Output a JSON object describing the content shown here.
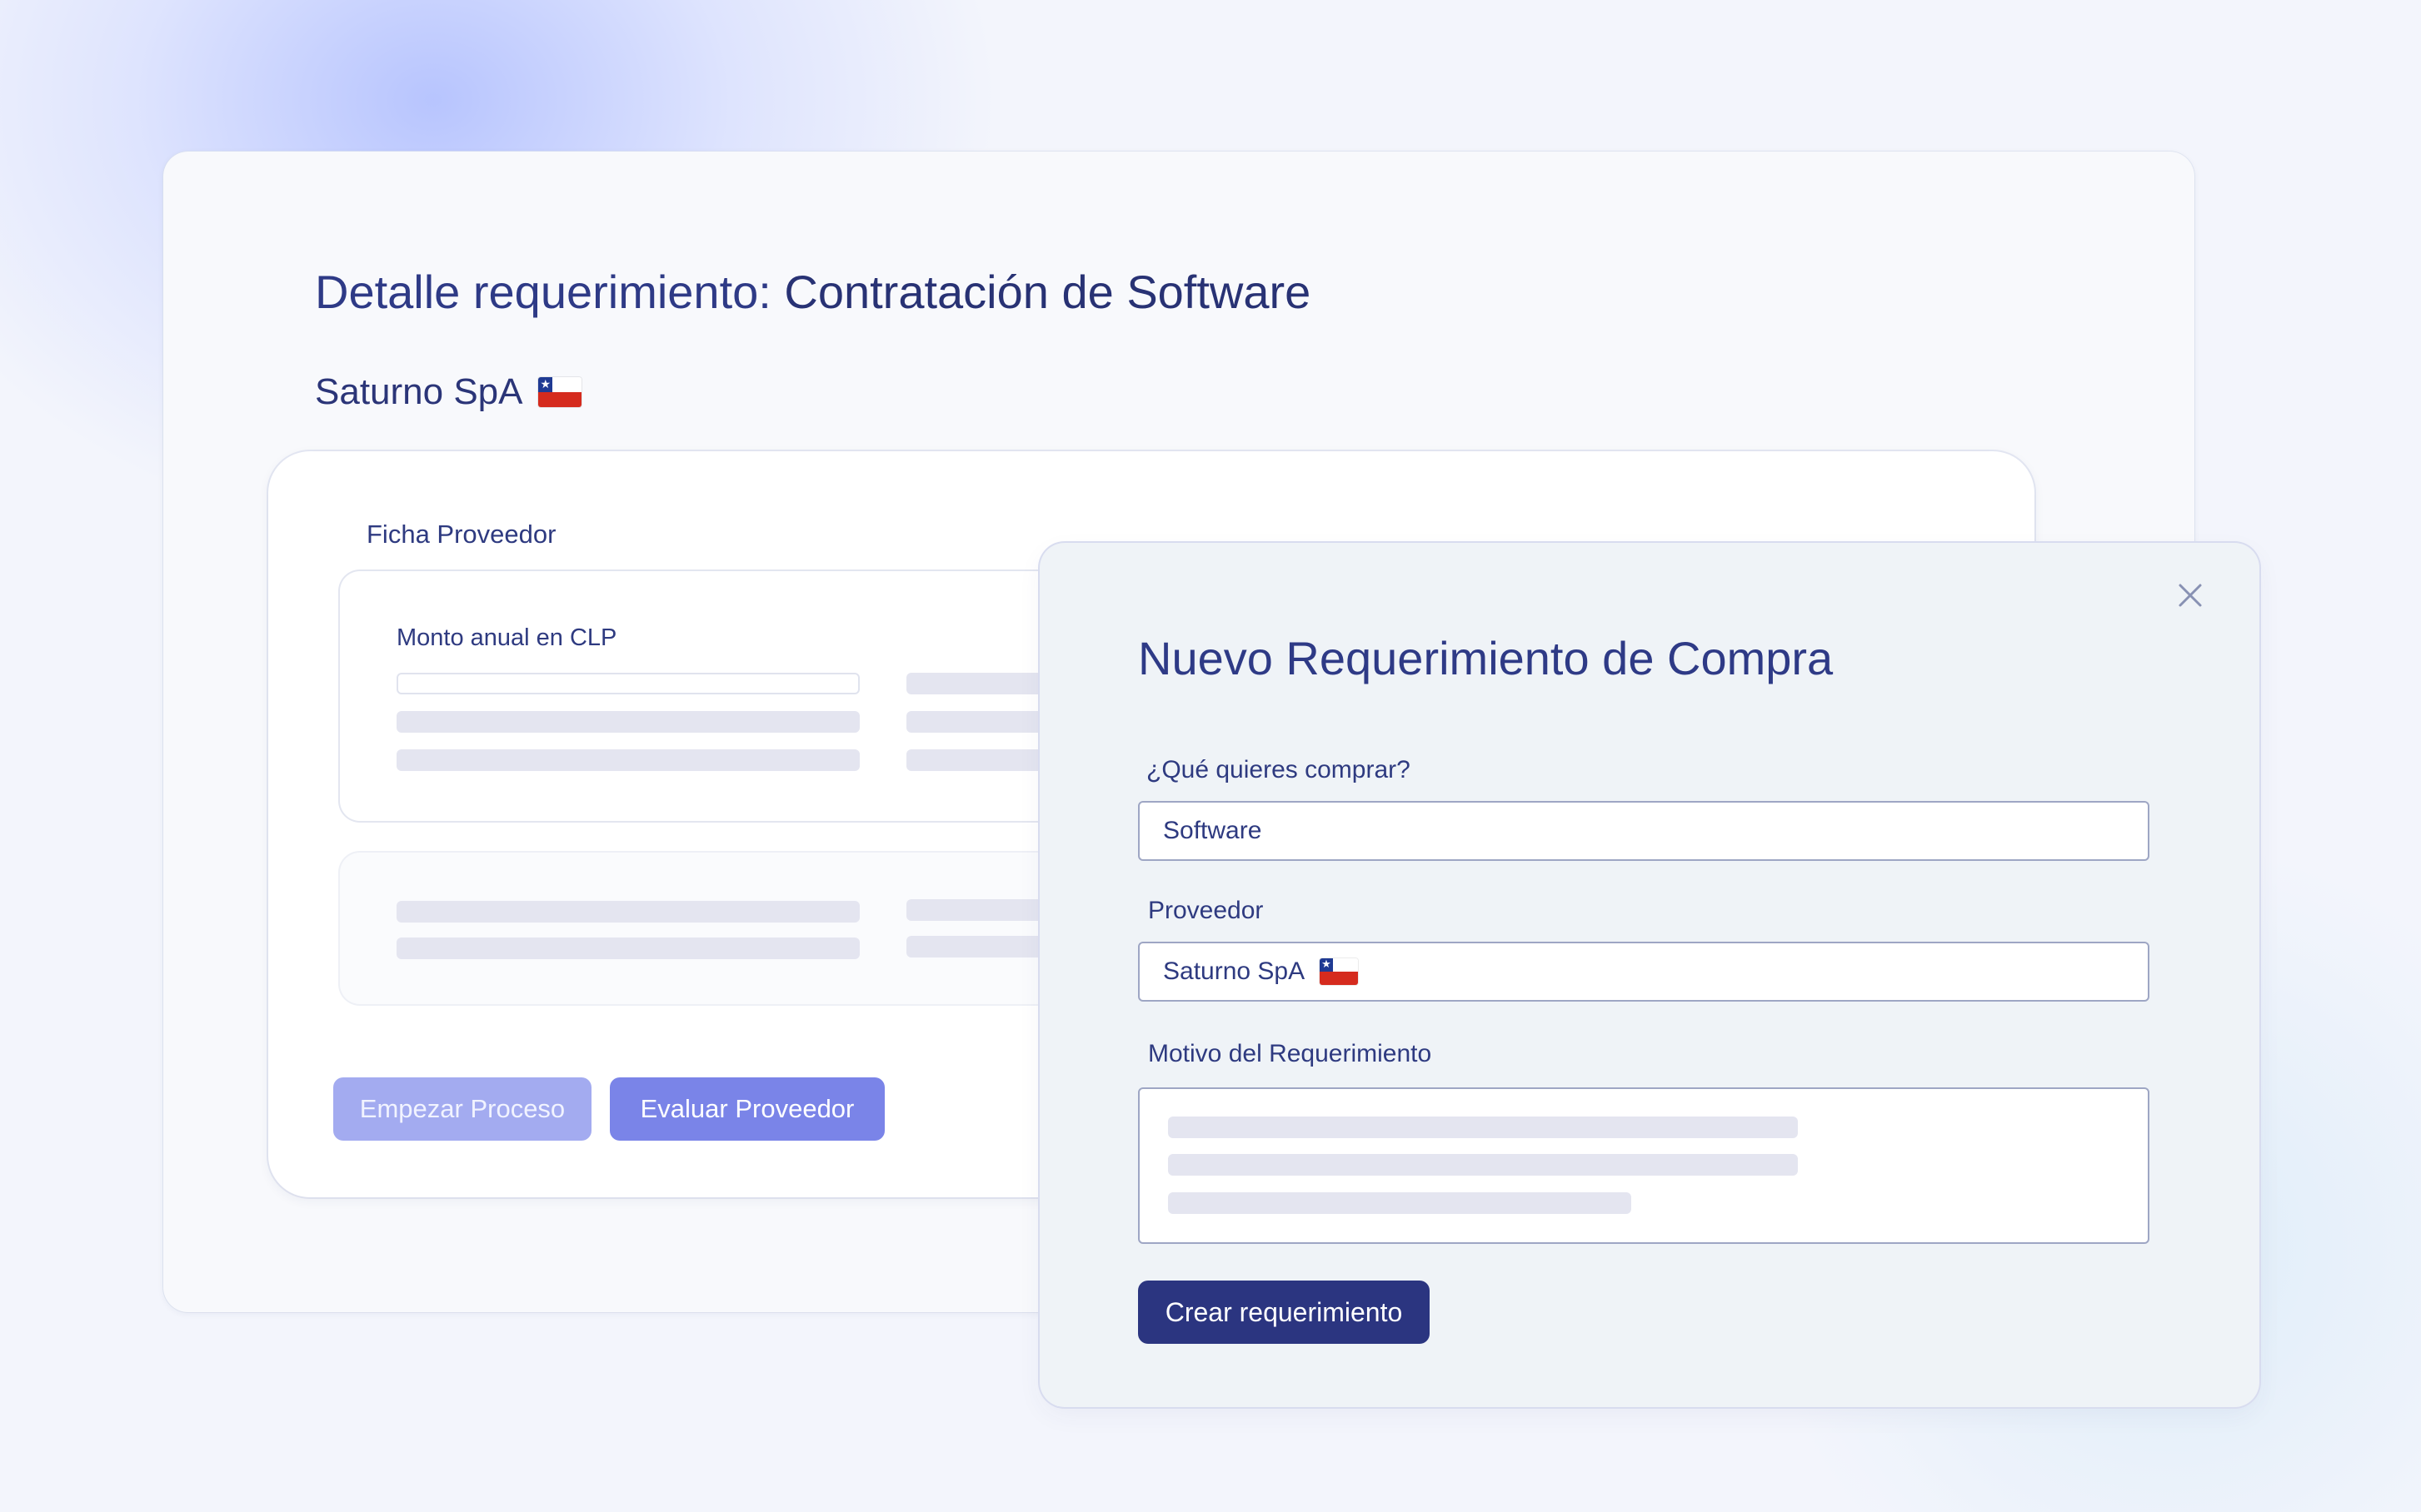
{
  "page": {
    "title_prefix": "Detalle requerimiento: ",
    "title_name": "Contratación de Software",
    "company_name": "Saturno SpA",
    "company_flag": "chile-flag-icon"
  },
  "ficha": {
    "label": "Ficha Proveedor",
    "monto_label": "Monto anual en CLP"
  },
  "actions": {
    "start_label": "Empezar Proceso",
    "evaluate_label": "Evaluar Proveedor"
  },
  "modal": {
    "title": "Nuevo Requerimiento de Compra",
    "close_icon": "close-icon",
    "what_label": "¿Qué quieres comprar?",
    "what_value": "Software",
    "supplier_label": "Proveedor",
    "supplier_value": "Saturno SpA",
    "supplier_flag": "chile-flag-icon",
    "reason_label": "Motivo del Requerimiento",
    "submit_label": "Crear requerimiento"
  },
  "colors": {
    "primary_dark": "#2b3580",
    "button_primary": "#7a84e8",
    "button_disabled": "#a3abf0",
    "text_primary": "#2e3a86",
    "skeleton": "#e4e5f0"
  }
}
